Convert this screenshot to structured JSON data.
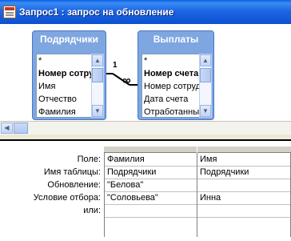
{
  "window": {
    "title": "Запрос1 : запрос на обновление"
  },
  "tables": [
    {
      "name": "Подрядчики",
      "fields": [
        "*",
        "Номер сотру",
        "Имя",
        "Отчество",
        "Фамилия"
      ],
      "bold_index": 1
    },
    {
      "name": "Выплаты",
      "fields": [
        "*",
        "Номер счета",
        "Номер сотрудни",
        "Дата счета",
        "Отработанные ч"
      ],
      "bold_index": 1
    }
  ],
  "relationship": {
    "one": "1",
    "many": "∞"
  },
  "design_grid": {
    "row_labels": [
      "Поле:",
      "Имя таблицы:",
      "Обновление:",
      "Условие отбора:",
      "или:"
    ],
    "columns": [
      {
        "cells": [
          "Фамилия",
          "Подрядчики",
          "\"Белова\"",
          "\"Соловьева\"",
          ""
        ]
      },
      {
        "cells": [
          "Имя",
          "Подрядчики",
          "",
          "Инна",
          ""
        ]
      }
    ]
  },
  "colors": {
    "title_bar": "#1e66e3",
    "table_header": "#7ea6e0"
  }
}
